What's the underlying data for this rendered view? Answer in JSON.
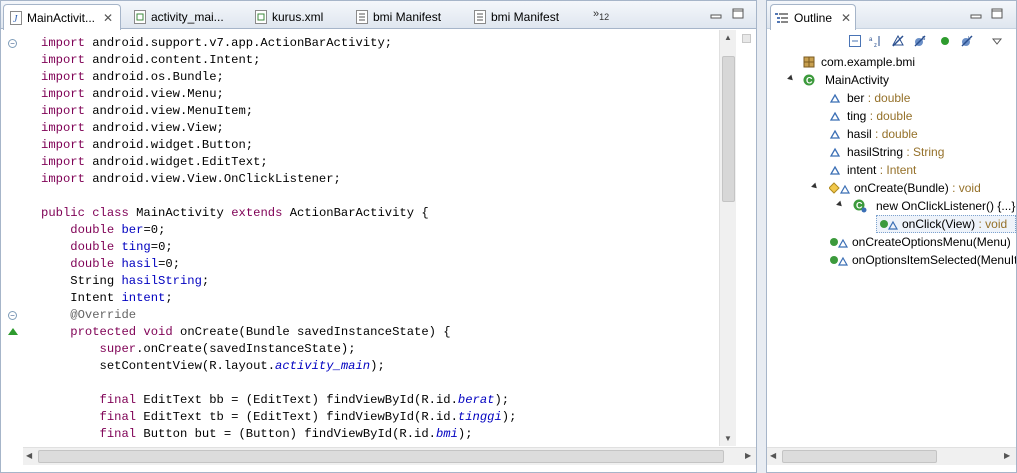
{
  "editor": {
    "tabs": [
      {
        "label": "MainActivit...",
        "close": "✕",
        "active": true
      },
      {
        "label": "activity_mai..."
      },
      {
        "label": "kurus.xml"
      },
      {
        "label": "bmi Manifest"
      },
      {
        "label": "bmi Manifest"
      }
    ],
    "overflow_label": "»",
    "overflow_count": "12",
    "code_lines": [
      [
        {
          "t": "import",
          "c": "kw"
        },
        {
          "t": " android.support.v7.app.ActionBarActivity;"
        }
      ],
      [
        {
          "t": "import",
          "c": "kw"
        },
        {
          "t": " android.content.Intent;"
        }
      ],
      [
        {
          "t": "import",
          "c": "kw"
        },
        {
          "t": " android.os.Bundle;"
        }
      ],
      [
        {
          "t": "import",
          "c": "kw"
        },
        {
          "t": " android.view.Menu;"
        }
      ],
      [
        {
          "t": "import",
          "c": "kw"
        },
        {
          "t": " android.view.MenuItem;"
        }
      ],
      [
        {
          "t": "import",
          "c": "kw"
        },
        {
          "t": " android.view.View;"
        }
      ],
      [
        {
          "t": "import",
          "c": "kw"
        },
        {
          "t": " android.widget.Button;"
        }
      ],
      [
        {
          "t": "import",
          "c": "kw"
        },
        {
          "t": " android.widget.EditText;"
        }
      ],
      [
        {
          "t": "import",
          "c": "kw"
        },
        {
          "t": " android.view.View.OnClickListener;"
        }
      ],
      [],
      [
        {
          "t": "public",
          "c": "kw"
        },
        {
          "t": " "
        },
        {
          "t": "class",
          "c": "kw"
        },
        {
          "t": " MainActivity "
        },
        {
          "t": "extends",
          "c": "kw"
        },
        {
          "t": " ActionBarActivity {"
        }
      ],
      [
        {
          "t": "    "
        },
        {
          "t": "double",
          "c": "kw"
        },
        {
          "t": " "
        },
        {
          "t": "ber",
          "c": "fld"
        },
        {
          "t": "=0;"
        }
      ],
      [
        {
          "t": "    "
        },
        {
          "t": "double",
          "c": "kw"
        },
        {
          "t": " "
        },
        {
          "t": "ting",
          "c": "fld"
        },
        {
          "t": "=0;"
        }
      ],
      [
        {
          "t": "    "
        },
        {
          "t": "double",
          "c": "kw"
        },
        {
          "t": " "
        },
        {
          "t": "hasil",
          "c": "fld"
        },
        {
          "t": "=0;"
        }
      ],
      [
        {
          "t": "    String "
        },
        {
          "t": "hasilString",
          "c": "fld"
        },
        {
          "t": ";"
        }
      ],
      [
        {
          "t": "    Intent "
        },
        {
          "t": "intent",
          "c": "fld"
        },
        {
          "t": ";"
        }
      ],
      [
        {
          "t": "    "
        },
        {
          "t": "@Override",
          "c": "ann"
        }
      ],
      [
        {
          "t": "    "
        },
        {
          "t": "protected",
          "c": "kw"
        },
        {
          "t": " "
        },
        {
          "t": "void",
          "c": "kw"
        },
        {
          "t": " onCreate(Bundle savedInstanceState) {"
        }
      ],
      [
        {
          "t": "        "
        },
        {
          "t": "super",
          "c": "kw"
        },
        {
          "t": ".onCreate(savedInstanceState);"
        }
      ],
      [
        {
          "t": "        setContentView(R.layout."
        },
        {
          "t": "activity_main",
          "c": "itf"
        },
        {
          "t": ");"
        }
      ],
      [],
      [
        {
          "t": "        "
        },
        {
          "t": "final",
          "c": "kw"
        },
        {
          "t": " EditText bb = (EditText) findViewById(R.id."
        },
        {
          "t": "berat",
          "c": "itf"
        },
        {
          "t": ");"
        }
      ],
      [
        {
          "t": "        "
        },
        {
          "t": "final",
          "c": "kw"
        },
        {
          "t": " EditText tb = (EditText) findViewById(R.id."
        },
        {
          "t": "tinggi",
          "c": "itf"
        },
        {
          "t": ");"
        }
      ],
      [
        {
          "t": "        "
        },
        {
          "t": "final",
          "c": "kw"
        },
        {
          "t": " Button but = (Button) findViewById(R.id."
        },
        {
          "t": "bmi",
          "c": "itf"
        },
        {
          "t": ");"
        }
      ]
    ]
  },
  "outline": {
    "tab_label": "Outline",
    "tab_close": "✕",
    "toolbar_icons": [
      "collapse-all-icon",
      "sort-az-icon",
      "hide-fields-icon",
      "hide-static-icon",
      "hide-non-public-icon",
      "hide-local-types-icon",
      "view-menu-icon"
    ],
    "package": "com.example.bmi",
    "class": "MainActivity",
    "fields": [
      {
        "name": "ber",
        "type": ": double"
      },
      {
        "name": "ting",
        "type": ": double"
      },
      {
        "name": "hasil",
        "type": ": double"
      },
      {
        "name": "hasilString",
        "type": ": String"
      },
      {
        "name": "intent",
        "type": ": Intent"
      }
    ],
    "methods": [
      {
        "name": "onCreate(Bundle)",
        "type": ": void"
      },
      {
        "name": "new OnClickListener() {...}",
        "type": ""
      },
      {
        "name": "onClick(View)",
        "type": ": void"
      },
      {
        "name": "onCreateOptionsMenu(Menu)",
        "type": ""
      },
      {
        "name": "onOptionsItemSelected(MenuItem)",
        "type": ""
      }
    ]
  },
  "colors": {
    "keyword": "#7f0055",
    "field": "#0000c0",
    "annotation": "#646464",
    "type_hint": "#95712a"
  }
}
